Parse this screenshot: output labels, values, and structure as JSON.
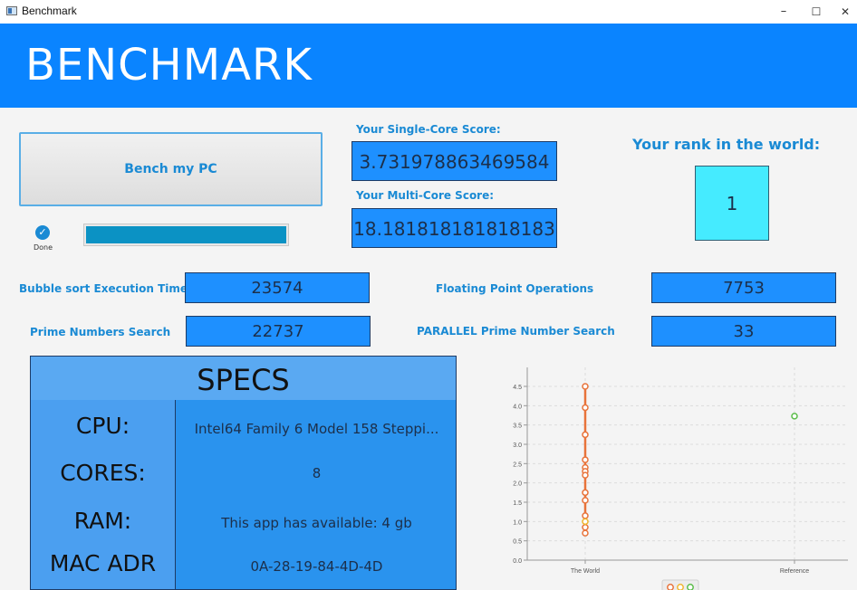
{
  "window": {
    "title": "Benchmark",
    "minimize": "–",
    "maximize": "☐",
    "close": "✕"
  },
  "header": {
    "title": "BENCHMARK"
  },
  "bench": {
    "button_label": "Bench my PC",
    "status_label": "Done",
    "progress": 1.0
  },
  "scores": {
    "single_label": "Your Single-Core Score:",
    "single_value": "3.731978863469584",
    "multi_label": "Your Multi-Core Score:",
    "multi_value": "18.181818181818183"
  },
  "rank": {
    "label": "Your rank in the world:",
    "value": "1"
  },
  "metrics": {
    "bubble_label": "Bubble sort Execution Time",
    "bubble_value": "23574",
    "prime_label": "Prime Numbers Search",
    "prime_value": "22737",
    "flop_label": "Floating Point Operations",
    "flop_value": "7753",
    "parallel_label": "PARALLEL Prime Number Search",
    "parallel_value": "33"
  },
  "specs": {
    "title": "SPECS",
    "rows": [
      {
        "key": "CPU:",
        "value": "Intel64 Family 6 Model 158 Steppi..."
      },
      {
        "key": "CORES:",
        "value": "8"
      },
      {
        "key": "RAM:",
        "value": "This app has available: 4 gb"
      },
      {
        "key": "MAC ADR",
        "value": "0A-28-19-84-4D-4D"
      }
    ]
  },
  "colors": {
    "header": "#0a84ff",
    "value_box": "#1e90ff",
    "rank_box": "#45ebff",
    "accent_text": "#1a8ad4"
  },
  "chart_data": {
    "type": "scatter",
    "categories": [
      "The World",
      "Reference"
    ],
    "ylim": [
      0,
      4.5
    ],
    "yticks": [
      "0.0",
      "0.5",
      "1.0",
      "1.5",
      "2.0",
      "2.5",
      "3.0",
      "3.5",
      "4.0",
      "4.5"
    ],
    "grid": true,
    "legend_position": "bottom",
    "series": [
      {
        "color": "#e8733a",
        "line": true,
        "points": [
          {
            "x": "The World",
            "y": 4.5
          },
          {
            "x": "The World",
            "y": 3.95
          },
          {
            "x": "The World",
            "y": 3.25
          },
          {
            "x": "The World",
            "y": 2.6
          },
          {
            "x": "The World",
            "y": 2.4
          },
          {
            "x": "The World",
            "y": 2.3
          },
          {
            "x": "The World",
            "y": 2.2
          },
          {
            "x": "The World",
            "y": 1.75
          },
          {
            "x": "The World",
            "y": 1.55
          },
          {
            "x": "The World",
            "y": 1.15
          },
          {
            "x": "The World",
            "y": 0.85
          },
          {
            "x": "The World",
            "y": 0.7
          }
        ]
      },
      {
        "color": "#f0b630",
        "line": false,
        "points": [
          {
            "x": "The World",
            "y": 1.0
          }
        ]
      },
      {
        "color": "#5bbd4a",
        "line": false,
        "points": [
          {
            "x": "Reference",
            "y": 3.73
          }
        ]
      }
    ]
  }
}
